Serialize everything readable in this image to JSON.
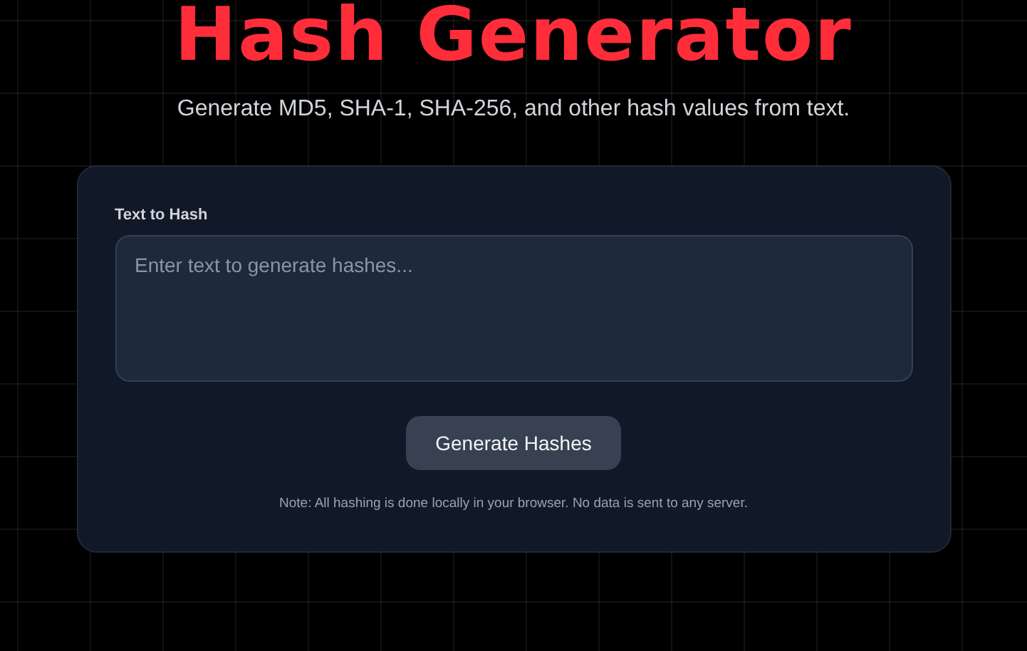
{
  "header": {
    "title": "Hash Generator",
    "subtitle": "Generate MD5, SHA-1, SHA-256, and other hash values from text."
  },
  "form": {
    "label": "Text to Hash",
    "placeholder": "Enter text to generate hashes...",
    "button": "Generate Hashes",
    "note": "Note: All hashing is done locally in your browser. No data is sent to any server."
  }
}
